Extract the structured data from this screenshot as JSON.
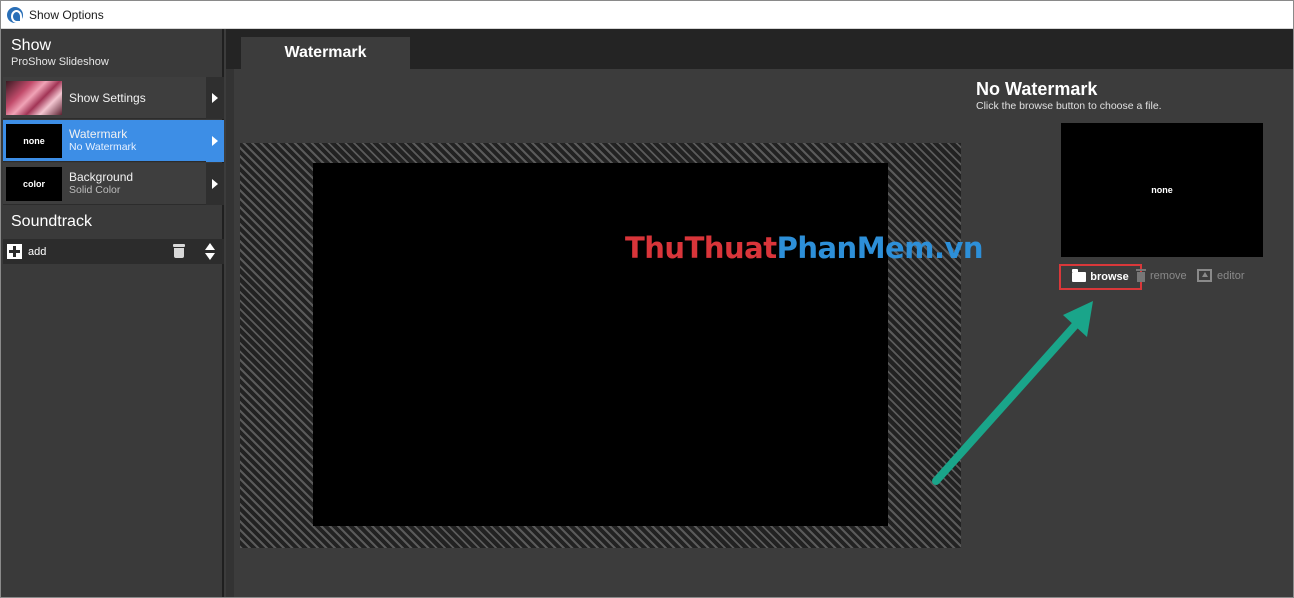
{
  "window": {
    "title": "Show Options"
  },
  "sidebar": {
    "show_heading": "Show",
    "show_subheading": "ProShow Slideshow",
    "items": [
      {
        "label": "Show Settings",
        "sub": "",
        "thumb": ""
      },
      {
        "label": "Watermark",
        "sub": "No Watermark",
        "thumb": "none"
      },
      {
        "label": "Background",
        "sub": "Solid Color",
        "thumb": "color"
      }
    ],
    "soundtrack_heading": "Soundtrack",
    "add_label": "add"
  },
  "tabs": [
    {
      "label": "Watermark"
    }
  ],
  "watermark": {
    "title": "No Watermark",
    "subtitle": "Click the browse button to choose a file.",
    "thumb_label": "none",
    "browse_label": "browse",
    "remove_label": "remove",
    "editor_label": "editor"
  },
  "overlay_logo": {
    "part1": "ThuThuat",
    "part2": "PhanMem",
    "part3": ".vn"
  },
  "colors": {
    "accent": "#3d8ee6",
    "highlight": "#d9383a",
    "annotation_arrow": "#1aa58a"
  }
}
